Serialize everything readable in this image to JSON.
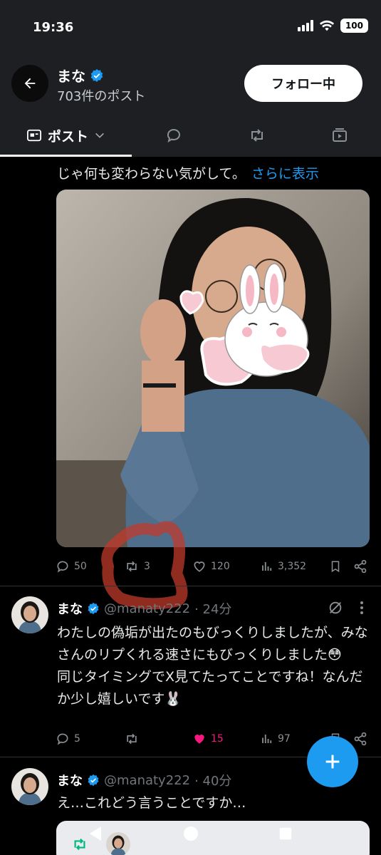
{
  "status_bar": {
    "time": "19:36",
    "battery": "100"
  },
  "header": {
    "name": "まな",
    "post_count": "703件のポスト",
    "follow_label": "フォロー中"
  },
  "tabs": [
    {
      "label": "ポスト",
      "icon": "posts-icon",
      "active": true
    },
    {
      "label": "",
      "icon": "reply-icon"
    },
    {
      "label": "",
      "icon": "repost-icon"
    },
    {
      "label": "",
      "icon": "media-icon"
    }
  ],
  "tweet1": {
    "text_partial": "じゃ何も変わらない気がして。",
    "more_label": "さらに表示",
    "replies": "50",
    "reposts": "3",
    "likes": "120",
    "views": "3,352"
  },
  "replies": [
    {
      "name": "まな",
      "handle": "@manaty222",
      "time": "· 24分",
      "text": "わたしの偽垢が出たのもびっくりしましたが、みなさんのリプくれる速さにもびっくりしました😳\n同じタイミングでX見てたってことですね！なんだか少し嬉しいです🐰",
      "reply_count": "5",
      "repost_count": "",
      "like_count": "15",
      "view_count": "97",
      "liked": true
    },
    {
      "name": "まな",
      "handle": "@manaty222",
      "time": "· 40分",
      "text": "え…これどう言うことですか…"
    }
  ],
  "colors": {
    "accent": "#1d9bf0",
    "like": "#f91880",
    "header_bg": "#1d1f22",
    "annotation": "#c0392b"
  }
}
